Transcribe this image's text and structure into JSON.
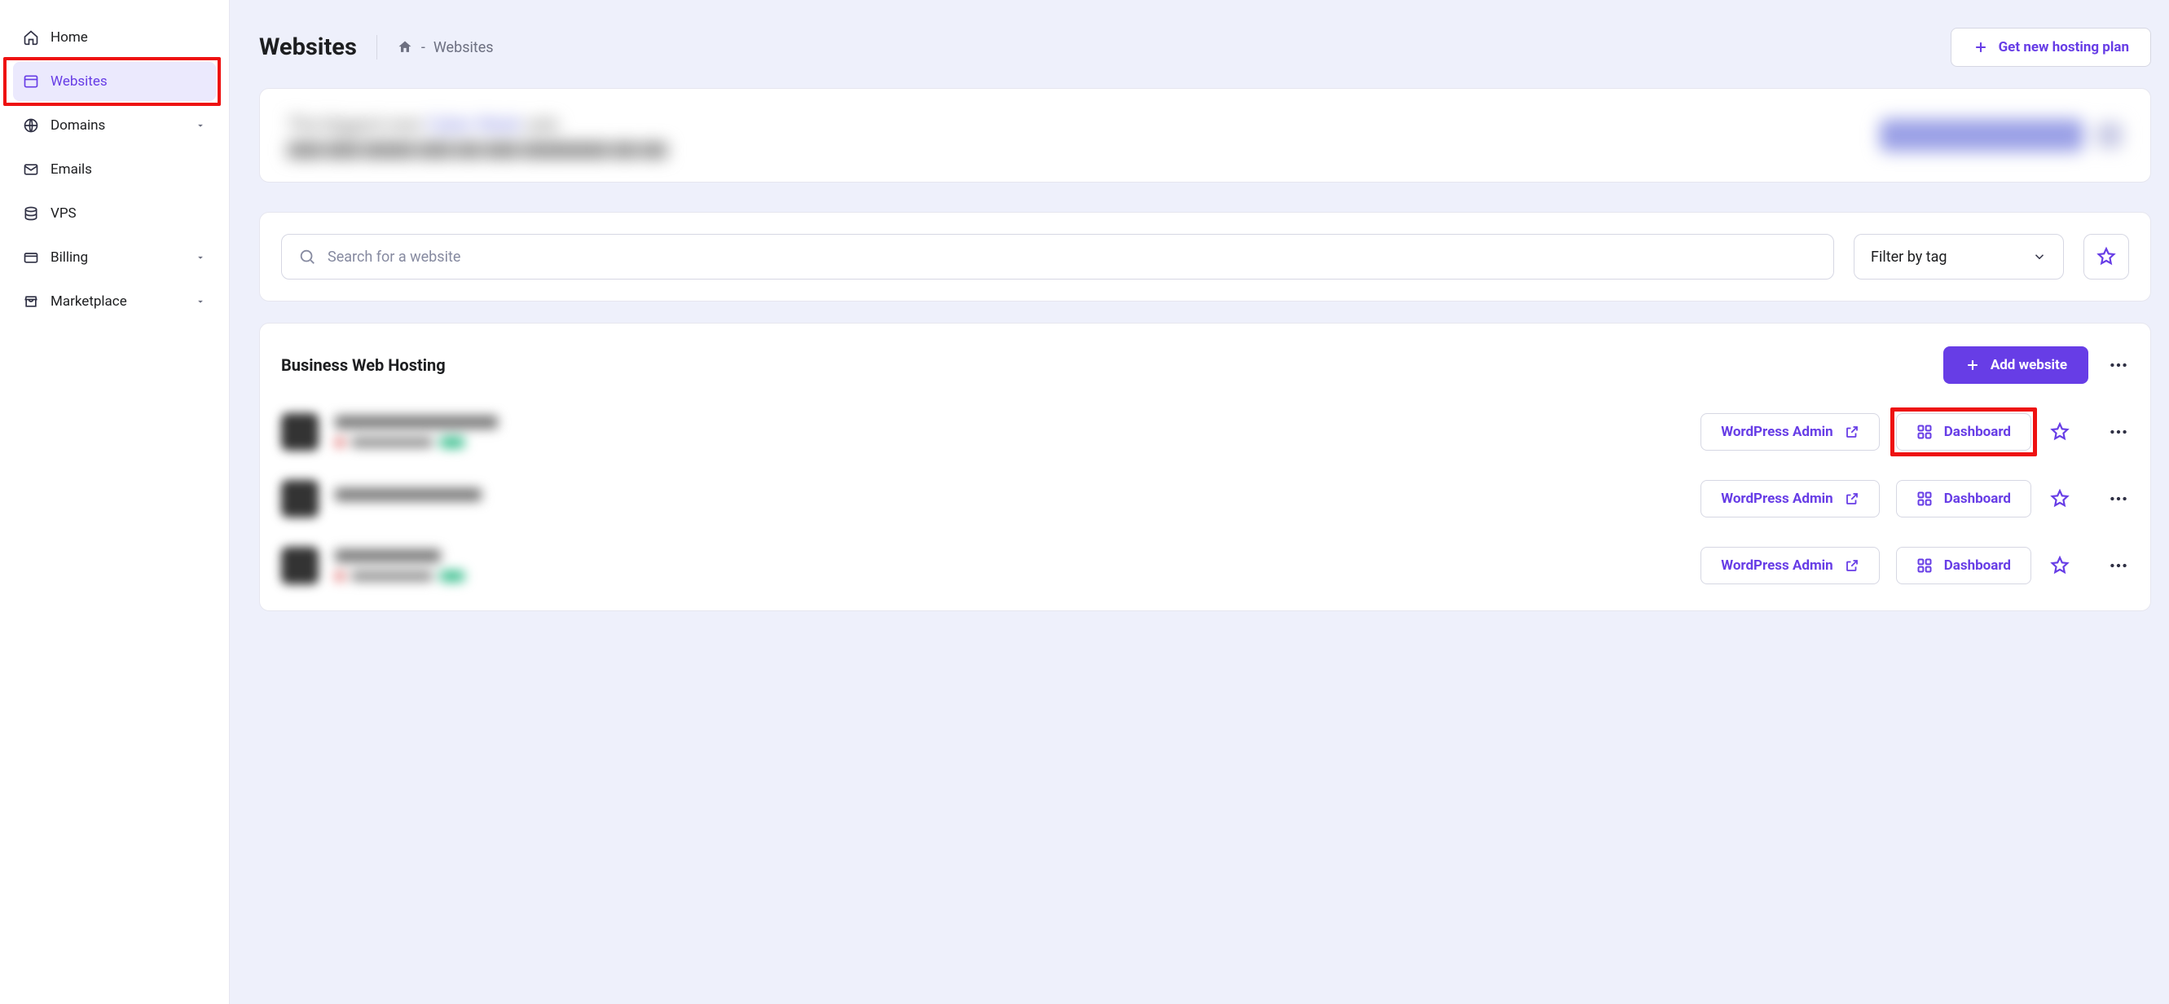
{
  "sidebar": {
    "items": [
      {
        "label": "Home"
      },
      {
        "label": "Websites"
      },
      {
        "label": "Domains"
      },
      {
        "label": "Emails"
      },
      {
        "label": "VPS"
      },
      {
        "label": "Billing"
      },
      {
        "label": "Marketplace"
      }
    ]
  },
  "header": {
    "title": "Websites",
    "breadcrumb_sep": "-",
    "breadcrumb_current": "Websites",
    "new_plan_label": "Get new hosting plan"
  },
  "search": {
    "placeholder": "Search for a website",
    "filter_label": "Filter by tag"
  },
  "plan": {
    "title": "Business Web Hosting",
    "add_label": "Add website",
    "wp_admin_label": "WordPress Admin",
    "dashboard_label": "Dashboard"
  }
}
